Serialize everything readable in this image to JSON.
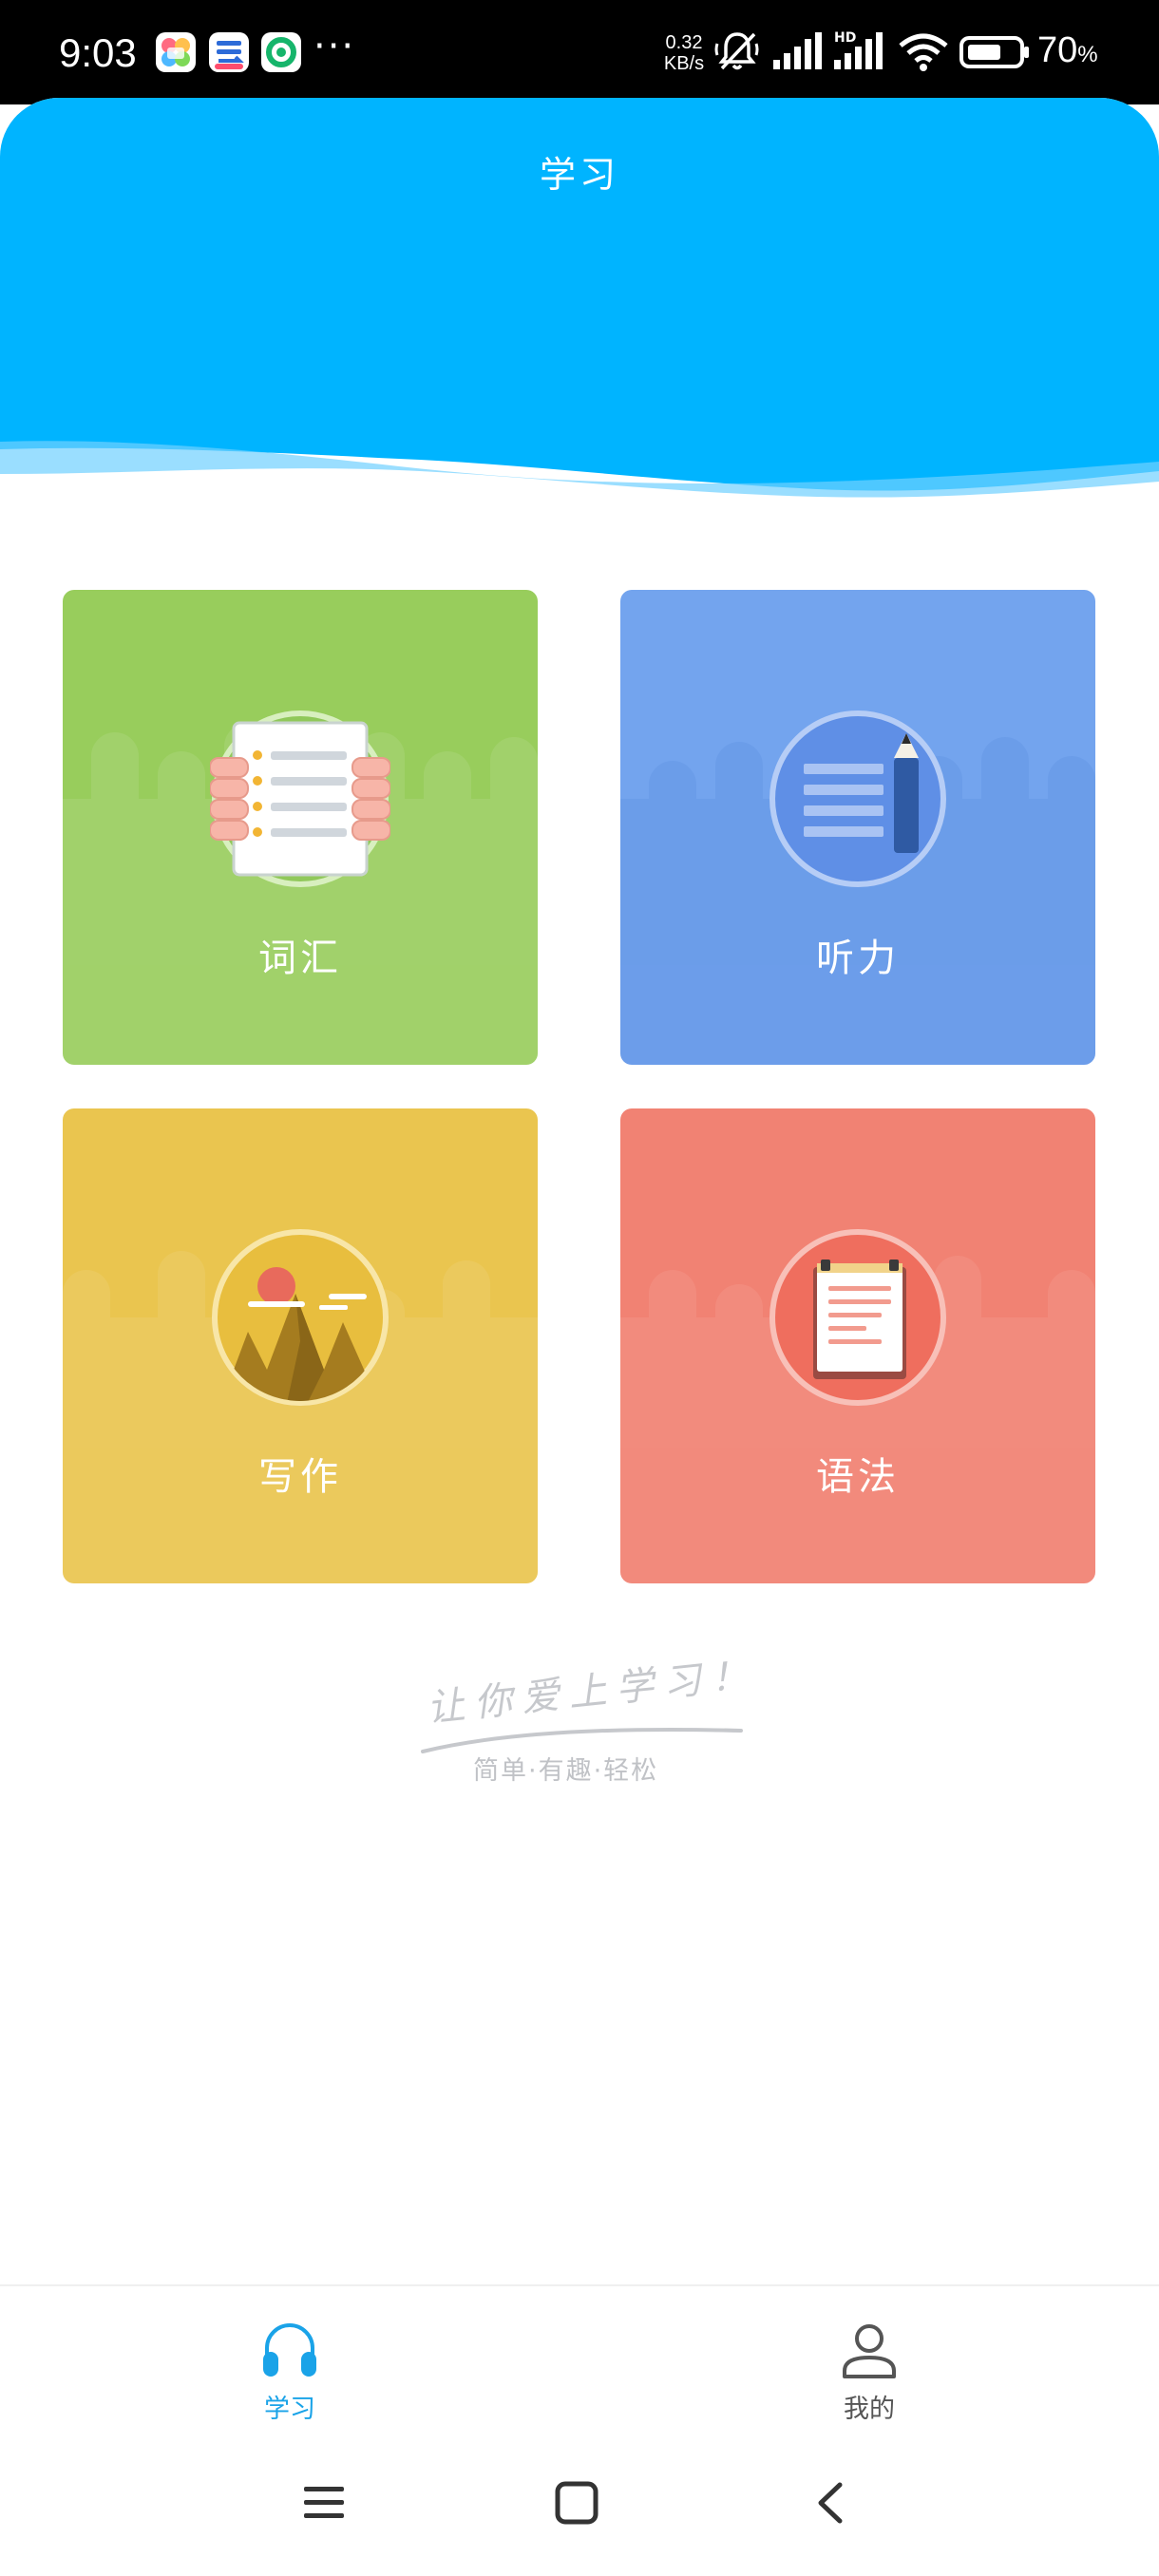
{
  "status_bar": {
    "time": "9:03",
    "more": "···",
    "net_speed_value": "0.32",
    "net_speed_unit": "KB/s",
    "battery_percent": "70",
    "battery_unit": "%",
    "icons": [
      "photos-app-icon",
      "cloud-app-icon",
      "green-app-icon",
      "mute-bell-icon",
      "signal-icon",
      "hd-signal-icon",
      "wifi-icon",
      "battery-icon"
    ]
  },
  "header": {
    "title": "学习",
    "color": "#00b4ff"
  },
  "tiles": [
    {
      "label": "词汇",
      "color": "#98cd5c",
      "icon": "notebook-icon"
    },
    {
      "label": "听力",
      "color": "#73a4ee",
      "icon": "notes-pencil-icon"
    },
    {
      "label": "写作",
      "color": "#eac54f",
      "icon": "mountain-sun-icon"
    },
    {
      "label": "语法",
      "color": "#f18273",
      "icon": "clipboard-icon"
    }
  ],
  "slogan": {
    "title": "让你爱上学习！",
    "subtitle": "简单·有趣·轻松"
  },
  "bottom_nav": {
    "items": [
      {
        "label": "学习",
        "icon": "headphones-icon",
        "active": true
      },
      {
        "label": "我的",
        "icon": "user-icon",
        "active": false
      }
    ],
    "active_color": "#1aa3e8",
    "inactive_color": "#555555"
  },
  "system_nav": {
    "icons": [
      "menu-icon",
      "home-icon",
      "back-icon"
    ]
  }
}
